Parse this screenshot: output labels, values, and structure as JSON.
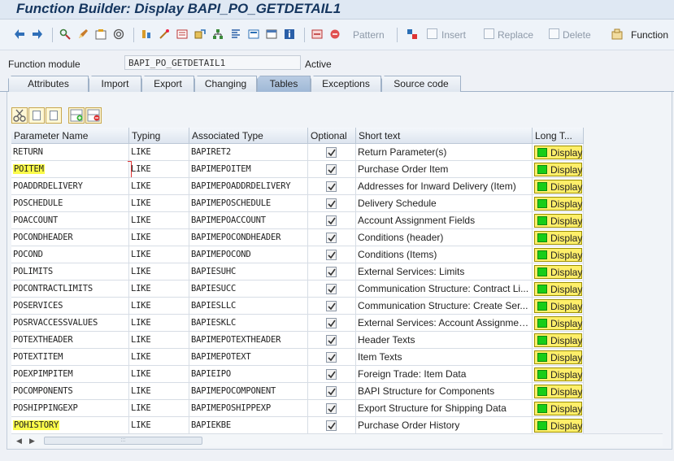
{
  "window": {
    "title": "Function Builder: Display BAPI_PO_GETDETAIL1"
  },
  "toolbar": {
    "pattern_label": "Pattern",
    "insert_label": "Insert",
    "replace_label": "Replace",
    "delete_label": "Delete",
    "function_label": "Function"
  },
  "function_module": {
    "label": "Function module",
    "value": "BAPI_PO_GETDETAIL1",
    "status": "Active"
  },
  "tabs": [
    {
      "label": "Attributes"
    },
    {
      "label": "Import"
    },
    {
      "label": "Export"
    },
    {
      "label": "Changing"
    },
    {
      "label": "Tables",
      "active": true
    },
    {
      "label": "Exceptions"
    },
    {
      "label": "Source code"
    }
  ],
  "table": {
    "columns": [
      "Parameter Name",
      "Typing",
      "Associated Type",
      "Optional",
      "Short text",
      "Long T..."
    ],
    "display_label": "Display",
    "rows": [
      {
        "name": "RETURN",
        "typing": "LIKE",
        "type": "BAPIRET2",
        "optional": true,
        "short_text": "Return Parameter(s)"
      },
      {
        "name": "POITEM",
        "typing": "LIKE",
        "type": "BAPIMEPOITEM",
        "optional": true,
        "short_text": "Purchase Order Item",
        "highlight": true
      },
      {
        "name": "POADDRDELIVERY",
        "typing": "LIKE",
        "type": "BAPIMEPOADDRDELIVERY",
        "optional": true,
        "short_text": "Addresses for Inward Delivery (Item)"
      },
      {
        "name": "POSCHEDULE",
        "typing": "LIKE",
        "type": "BAPIMEPOSCHEDULE",
        "optional": true,
        "short_text": "Delivery Schedule"
      },
      {
        "name": "POACCOUNT",
        "typing": "LIKE",
        "type": "BAPIMEPOACCOUNT",
        "optional": true,
        "short_text": "Account Assignment Fields"
      },
      {
        "name": "POCONDHEADER",
        "typing": "LIKE",
        "type": "BAPIMEPOCONDHEADER",
        "optional": true,
        "short_text": "Conditions (header)"
      },
      {
        "name": "POCOND",
        "typing": "LIKE",
        "type": "BAPIMEPOCOND",
        "optional": true,
        "short_text": "Conditions (Items)"
      },
      {
        "name": "POLIMITS",
        "typing": "LIKE",
        "type": "BAPIESUHC",
        "optional": true,
        "short_text": "External Services: Limits"
      },
      {
        "name": "POCONTRACTLIMITS",
        "typing": "LIKE",
        "type": "BAPIESUCC",
        "optional": true,
        "short_text": "Communication Structure: Contract Li..."
      },
      {
        "name": "POSERVICES",
        "typing": "LIKE",
        "type": "BAPIESLLC",
        "optional": true,
        "short_text": "Communication Structure: Create Ser..."
      },
      {
        "name": "POSRVACCESSVALUES",
        "typing": "LIKE",
        "type": "BAPIESKLC",
        "optional": true,
        "short_text": "External Services: Account Assignmen..."
      },
      {
        "name": "POTEXTHEADER",
        "typing": "LIKE",
        "type": "BAPIMEPOTEXTHEADER",
        "optional": true,
        "short_text": "Header Texts"
      },
      {
        "name": "POTEXTITEM",
        "typing": "LIKE",
        "type": "BAPIMEPOTEXT",
        "optional": true,
        "short_text": "Item Texts"
      },
      {
        "name": "POEXPIMPITEM",
        "typing": "LIKE",
        "type": "BAPIEIPO",
        "optional": true,
        "short_text": "Foreign Trade: Item Data"
      },
      {
        "name": "POCOMPONENTS",
        "typing": "LIKE",
        "type": "BAPIMEPOCOMPONENT",
        "optional": true,
        "short_text": "BAPI Structure for Components"
      },
      {
        "name": "POSHIPPINGEXP",
        "typing": "LIKE",
        "type": "BAPIMEPOSHIPPEXP",
        "optional": true,
        "short_text": "Export Structure for Shipping Data"
      },
      {
        "name": "POHISTORY",
        "typing": "LIKE",
        "type": "BAPIEKBE",
        "optional": true,
        "short_text": "Purchase Order History",
        "highlight": true
      }
    ]
  },
  "colors": {
    "title": "#15365f",
    "highlight": "#fbfb4a",
    "display_button": "#ffef6a",
    "display_icon": "#18cd18",
    "active_tab": "#9fb8d6"
  }
}
